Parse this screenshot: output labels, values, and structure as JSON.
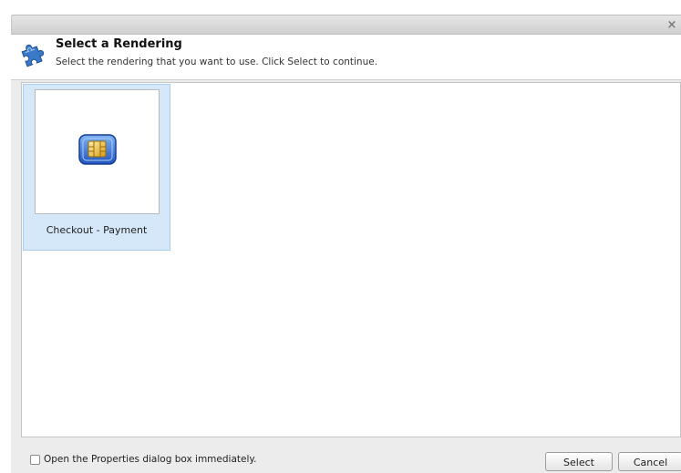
{
  "dialog": {
    "close_symbol": "×"
  },
  "header": {
    "icon": "puzzle-piece-icon",
    "title": "Select a Rendering",
    "subtitle": "Select the rendering that you want to use. Click Select to continue."
  },
  "renderings": [
    {
      "label": "Checkout - Payment",
      "icon": "sim-card-icon",
      "selected": true
    }
  ],
  "footer": {
    "checkbox_label": "Open the Properties dialog box immediately.",
    "checkbox_checked": false,
    "select_label": "Select",
    "cancel_label": "Cancel"
  },
  "colors": {
    "selection_background": "#d5e8f9",
    "selection_border": "#a9cdef",
    "icon_blue": "#2f6ad6",
    "icon_gold": "#e6b422"
  }
}
